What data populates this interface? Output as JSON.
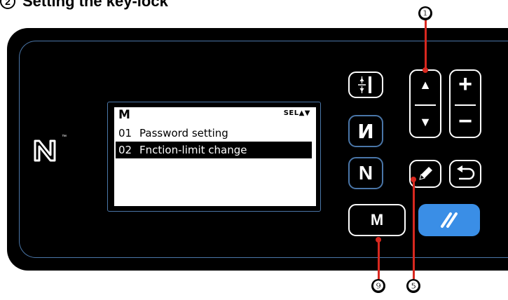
{
  "heading": {
    "circle_label": "2",
    "text": "Setting the key-lock"
  },
  "lcd": {
    "title": "M",
    "sel_indicator": "SEL▲▼",
    "rows": [
      {
        "num": "01",
        "label": "Password setting"
      },
      {
        "num": "02",
        "label": "Fnction-limit change"
      }
    ],
    "selected_index": 1
  },
  "buttons": {
    "m_label": "M",
    "n_label": "N",
    "reverse_label": "И",
    "plus_symbol": "+",
    "minus_symbol": "−",
    "up_symbol": "▲",
    "down_symbol": "▼"
  },
  "callouts": {
    "top": "❶",
    "edit": "❺",
    "m": "❾"
  },
  "colors": {
    "panel": "#000000",
    "panel_border": "#4a76a8",
    "reset_button": "#3a8ee6",
    "callout_line": "#d8281f"
  }
}
